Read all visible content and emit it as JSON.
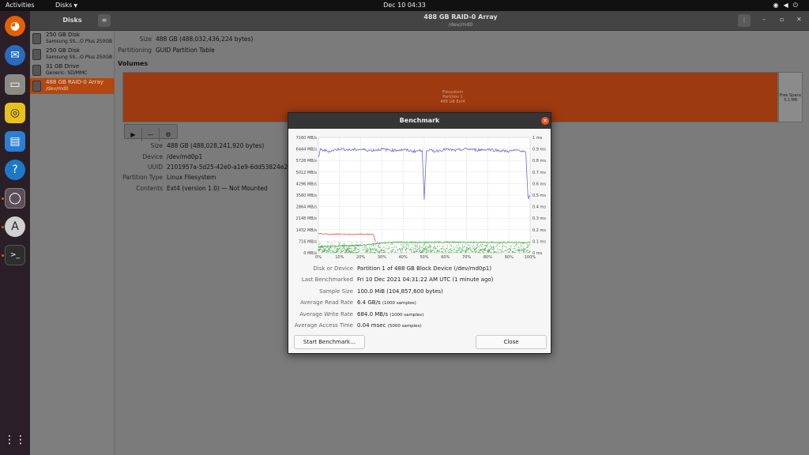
{
  "topbar": {
    "activities": "Activities",
    "app_menu": "Disks",
    "clock": "Dec 10  04:33"
  },
  "dock": {
    "items": [
      "firefox-icon",
      "thunderbird-icon",
      "files-icon",
      "rhythmbox-icon",
      "libreoffice-writer-icon",
      "help-icon",
      "disks-icon",
      "software-updater-icon",
      "terminal-icon"
    ],
    "show_apps": "show-applications-icon"
  },
  "window": {
    "sidebar_title": "Disks",
    "title": "488 GB RAID-0 Array",
    "subtitle": "/dev/md0"
  },
  "disks": [
    {
      "name": "250 GB Disk",
      "desc": "Samsung SS...O Plus 250GB"
    },
    {
      "name": "250 GB Disk",
      "desc": "Samsung SS...O Plus 250GB"
    },
    {
      "name": "31 GB Drive",
      "desc": "Generic- SD/MMC"
    },
    {
      "name": "488 GB RAID-0 Array",
      "desc": "/dev/md0"
    }
  ],
  "drive_info": {
    "size_label": "Size",
    "size": "488 GB (488,032,436,224 bytes)",
    "partitioning_label": "Partitioning",
    "partitioning": "GUID Partition Table"
  },
  "volumes": {
    "heading": "Volumes",
    "partition_label_lines": [
      "Filesystem",
      "Partition 1",
      "488 GB Ext4"
    ],
    "free_space_lines": [
      "Free Space",
      "3.1 MB"
    ]
  },
  "partition_info": {
    "size_label": "Size",
    "size": "488 GB (488,028,241,920 bytes)",
    "device_label": "Device",
    "device": "/dev/md0p1",
    "uuid_label": "UUID",
    "uuid": "2101957a-5d25-42e0-a1e9-6dd53824e281",
    "ptype_label": "Partition Type",
    "ptype": "Linux Filesystem",
    "contents_label": "Contents",
    "contents": "Ext4 (version 1.0) — Not Mounted"
  },
  "benchmark": {
    "title": "Benchmark",
    "disk_label": "Disk or Device",
    "disk": "Partition 1 of 488 GB Block Device (/dev/md0p1)",
    "last_label": "Last Benchmarked",
    "last": "Fri 10 Dec 2021 04:31:22 AM UTC (1 minute ago)",
    "sample_size_label": "Sample Size",
    "sample_size": "100.0 MiB (104,857,600 bytes)",
    "read_label": "Average Read Rate",
    "read": "6.4 GB/s",
    "read_samples": "(1000 samples)",
    "write_label": "Average Write Rate",
    "write": "684.0 MB/s",
    "write_samples": "(1000 samples)",
    "access_label": "Average Access Time",
    "access": "0.04 msec",
    "access_samples": "(5000 samples)",
    "start_button": "Start Benchmark…",
    "close_button": "Close"
  },
  "chart_data": {
    "type": "line",
    "x_ticks": [
      "0%",
      "10%",
      "20%",
      "30%",
      "40%",
      "50%",
      "60%",
      "70%",
      "80%",
      "90%",
      "100%"
    ],
    "y_left_ticks": [
      "0 MB/s",
      "716 MB/s",
      "1432 MB/s",
      "2148 MB/s",
      "2864 MB/s",
      "3580 MB/s",
      "4296 MB/s",
      "5012 MB/s",
      "5728 MB/s",
      "6444 MB/s",
      "7160 MB/s"
    ],
    "y_right_ticks": [
      "0 ms",
      "0.1 ms",
      "0.2 ms",
      "0.3 ms",
      "0.4 ms",
      "0.5 ms",
      "0.6 ms",
      "0.7 ms",
      "0.8 ms",
      "0.9 ms",
      "1 ms"
    ],
    "ylim": [
      0,
      7160
    ],
    "y2lim": [
      0,
      1
    ],
    "series": [
      {
        "color": "#6b6bdb",
        "x": [
          0,
          1,
          5,
          10,
          15,
          20,
          25,
          30,
          35,
          40,
          45,
          49,
          50,
          51,
          55,
          60,
          65,
          70,
          75,
          80,
          85,
          90,
          95,
          98,
          99,
          100
        ],
        "y": [
          5900,
          6400,
          6300,
          6450,
          6380,
          6420,
          6350,
          6430,
          6360,
          6400,
          6300,
          6350,
          3300,
          6400,
          6300,
          6420,
          6350,
          6450,
          6380,
          6420,
          6350,
          6300,
          6380,
          6200,
          3400,
          3500
        ]
      },
      {
        "color": "#e05050",
        "x": [
          0,
          5,
          10,
          15,
          20,
          25,
          26,
          27
        ],
        "y": [
          1200,
          1150,
          1170,
          1140,
          1160,
          1150,
          1120,
          700
        ]
      },
      {
        "color": "#3a9a3a",
        "x": [
          0,
          10,
          20,
          27,
          30,
          40,
          50,
          60,
          70,
          80,
          90,
          100
        ],
        "y": [
          380,
          420,
          470,
          560,
          620,
          650,
          640,
          660,
          650,
          640,
          640,
          620
        ]
      }
    ],
    "access_time": {
      "color": "#3a9a3a",
      "range_ms": [
        0.0,
        0.1
      ]
    }
  }
}
